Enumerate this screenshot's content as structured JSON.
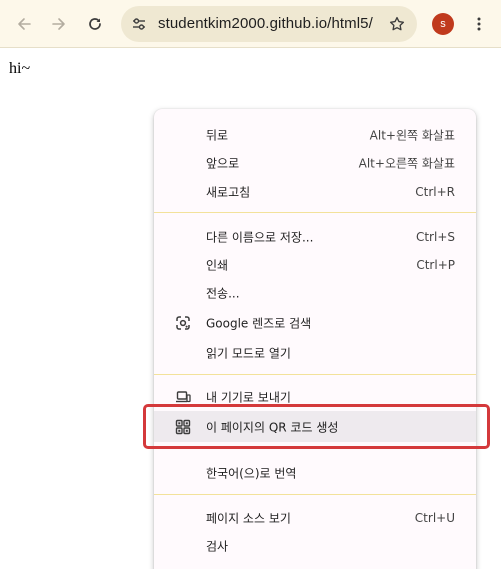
{
  "toolbar": {
    "back_icon": "arrow-left-icon",
    "forward_icon": "arrow-right-icon",
    "reload_icon": "reload-icon",
    "site_info_icon": "tune-icon",
    "url": "studentkim2000.github.io/html5/",
    "bookmark_icon": "star-icon",
    "profile_initial": "s",
    "profile_color": "#c03a1d",
    "menu_icon": "kebab-menu-icon"
  },
  "page": {
    "text": "hi~"
  },
  "context_menu": {
    "items": [
      {
        "label": "뒤로",
        "shortcut": "Alt+왼쪽 화살표"
      },
      {
        "label": "앞으로",
        "shortcut": "Alt+오른쪽 화살표"
      },
      {
        "label": "새로고침",
        "shortcut": "Ctrl+R"
      },
      {
        "label": "다른 이름으로 저장...",
        "shortcut": "Ctrl+S"
      },
      {
        "label": "인쇄",
        "shortcut": "Ctrl+P"
      },
      {
        "label": "전송...",
        "shortcut": ""
      },
      {
        "label": "Google 렌즈로 검색",
        "shortcut": "",
        "icon": "google-lens-icon"
      },
      {
        "label": "읽기 모드로 열기",
        "shortcut": ""
      },
      {
        "label": "내 기기로 보내기",
        "shortcut": "",
        "icon": "send-to-device-icon"
      },
      {
        "label": "이 페이지의 QR 코드 생성",
        "shortcut": "",
        "icon": "qr-code-icon",
        "highlighted": true
      },
      {
        "label": "한국어(으)로 번역",
        "shortcut": ""
      },
      {
        "label": "페이지 소스 보기",
        "shortcut": "Ctrl+U"
      },
      {
        "label": "검사",
        "shortcut": ""
      }
    ],
    "highlight_color": "#d4393b"
  }
}
